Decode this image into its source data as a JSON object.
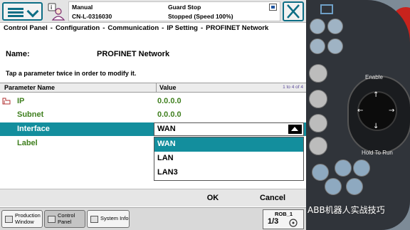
{
  "status": {
    "mode": "Manual",
    "controller": "CN-L-0316030",
    "safety": "Guard Stop",
    "state": "Stopped (Speed 100%)"
  },
  "breadcrumb": [
    "Control Panel",
    "Configuration",
    "Communication",
    "IP Setting",
    "PROFINET Network"
  ],
  "page": {
    "name_label": "Name:",
    "name_value": "PROFINET Network",
    "hint": "Tap a parameter twice in order to modify it."
  },
  "table": {
    "col_name": "Parameter Name",
    "col_value": "Value",
    "count": "1 to 4 of 4",
    "rows": [
      {
        "name": "IP",
        "value": "0.0.0.0"
      },
      {
        "name": "Subnet",
        "value": "0.0.0.0"
      },
      {
        "name": "Interface",
        "value": "WAN"
      },
      {
        "name": "Label",
        "value": ""
      }
    ]
  },
  "dropdown": {
    "selected": "WAN",
    "options": [
      "WAN",
      "LAN",
      "LAN3"
    ]
  },
  "buttons": {
    "ok": "OK",
    "cancel": "Cancel"
  },
  "taskbar": {
    "production": "Production\nWindow",
    "control": "Control\nPanel",
    "sysinfo": "System Info",
    "rob_label": "ROB_1",
    "rob_fraction": "1/3"
  },
  "pendant": {
    "enable_label": "Enable",
    "hold_label": "Hold To Run"
  },
  "watermark": "ABB机器人实战技巧",
  "colors": {
    "accent": "#138e9d",
    "param_text": "#3f7f1e",
    "frame": "#0d6e85"
  }
}
